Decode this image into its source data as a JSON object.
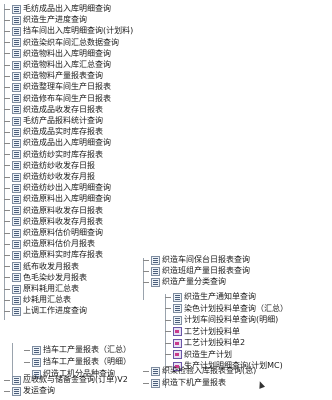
{
  "left_items": [
    "毛纺成品出入库明细查询",
    "织造生产进度查询",
    "挡车间出入库明细查询(计划料)",
    "织造染织车间汇总数据查询",
    "织造物料出入库明细查询",
    "织造物料出入库汇总查询",
    "织造物料产量报表查询",
    "织造整理车间生产日报表",
    "织造修布车间生产日报表",
    "织造成品收发存日报表",
    "毛纺产品报料统计查询",
    "织造成品实时库存报表",
    "织造成品出入库明细查询",
    "织造纺纱实时库存报表",
    "织造纺纱收发存日报",
    "织造纺纱收发存月报",
    "织造纺纱出入库明细查询",
    "织造原料出入库明细查询",
    "织造原料收发存日报表",
    "织造原料收发存月报表",
    "织造原料估价明细查询",
    "织造原料估价月报表",
    "织造原料实时库存报表",
    "纸布收发月报表",
    "色毛染纱发月报表",
    "原料耗用汇总表",
    "纱耗用汇总表",
    "上调工作进度查询"
  ],
  "left_lower": [
    "挡车工产量报表（汇总）",
    "挡车工产量报表（明细）",
    "织造工机分品种查询"
  ],
  "left_bottom": [
    "应收款与储备金查询(订单)V2",
    "发运查询"
  ],
  "right_top": [
    "织造车间保台日报表查询",
    "织造班组产量日报表查询",
    "织造产量分类查询"
  ],
  "right_children": [
    "织造生产通知单查询",
    "染色计划投料单查询（汇总）",
    "计划车间投料单查询(明细)",
    "工艺计划投料单",
    "工艺计划投料单2",
    "织造生产计划",
    "生产计划明细查询(计划MC)"
  ],
  "right_bottom": [
    "织染检验入库报表查询(总)",
    "织造下机产量报表"
  ],
  "icons": {
    "report": "report-list-icon",
    "form": "form-icon"
  }
}
